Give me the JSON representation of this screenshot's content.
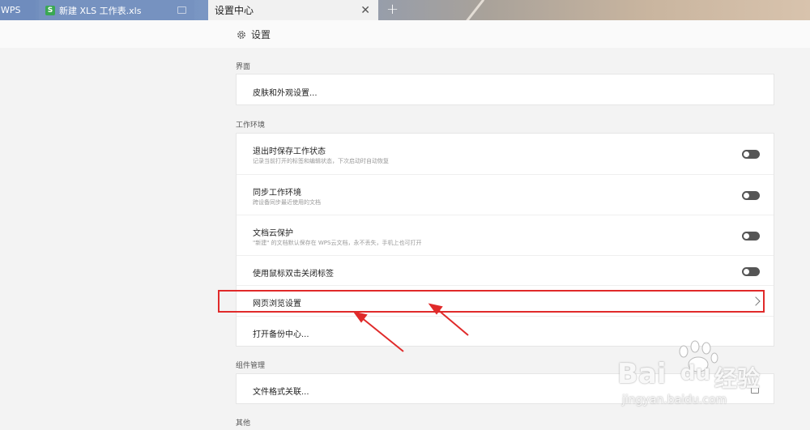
{
  "tabs": [
    {
      "label": "WPS"
    },
    {
      "label": "新建 XLS 工作表.xls",
      "badge": "S"
    },
    {
      "label": "设置中心"
    }
  ],
  "header": {
    "title": "设置",
    "icon": "gear-icon"
  },
  "sections": {
    "interface": {
      "label": "界面",
      "rows": [
        {
          "title": "皮肤和外观设置..."
        }
      ]
    },
    "workspace": {
      "label": "工作环境",
      "rows": [
        {
          "title": "退出时保存工作状态",
          "desc": "记录当前打开的标签和编辑状态，下次启动时自动恢复",
          "control": "toggle",
          "state": "off"
        },
        {
          "title": "同步工作环境",
          "desc": "跨设备同步最近使用的文档",
          "control": "toggle",
          "state": "off"
        },
        {
          "title": "文档云保护",
          "desc": "\"新建\" 的文档默认保存在 WPS云文档，永不丢失，手机上也可打开",
          "control": "toggle",
          "state": "off"
        },
        {
          "title": "使用鼠标双击关闭标签",
          "control": "toggle",
          "state": "off"
        },
        {
          "title": "网页浏览设置",
          "control": "chevron-right-icon"
        },
        {
          "title": "打开备份中心..."
        }
      ]
    },
    "components": {
      "label": "组件管理",
      "rows": [
        {
          "title": "文件格式关联...",
          "control": "external-link-icon"
        }
      ]
    },
    "other": {
      "label": "其他"
    }
  },
  "watermark": {
    "brand": "Bai",
    "brand2": "du",
    "cn": "经验",
    "url": "jingyan.baidu.com"
  },
  "colors": {
    "annotation": "#e02a2a",
    "xls_green": "#3aa853"
  }
}
